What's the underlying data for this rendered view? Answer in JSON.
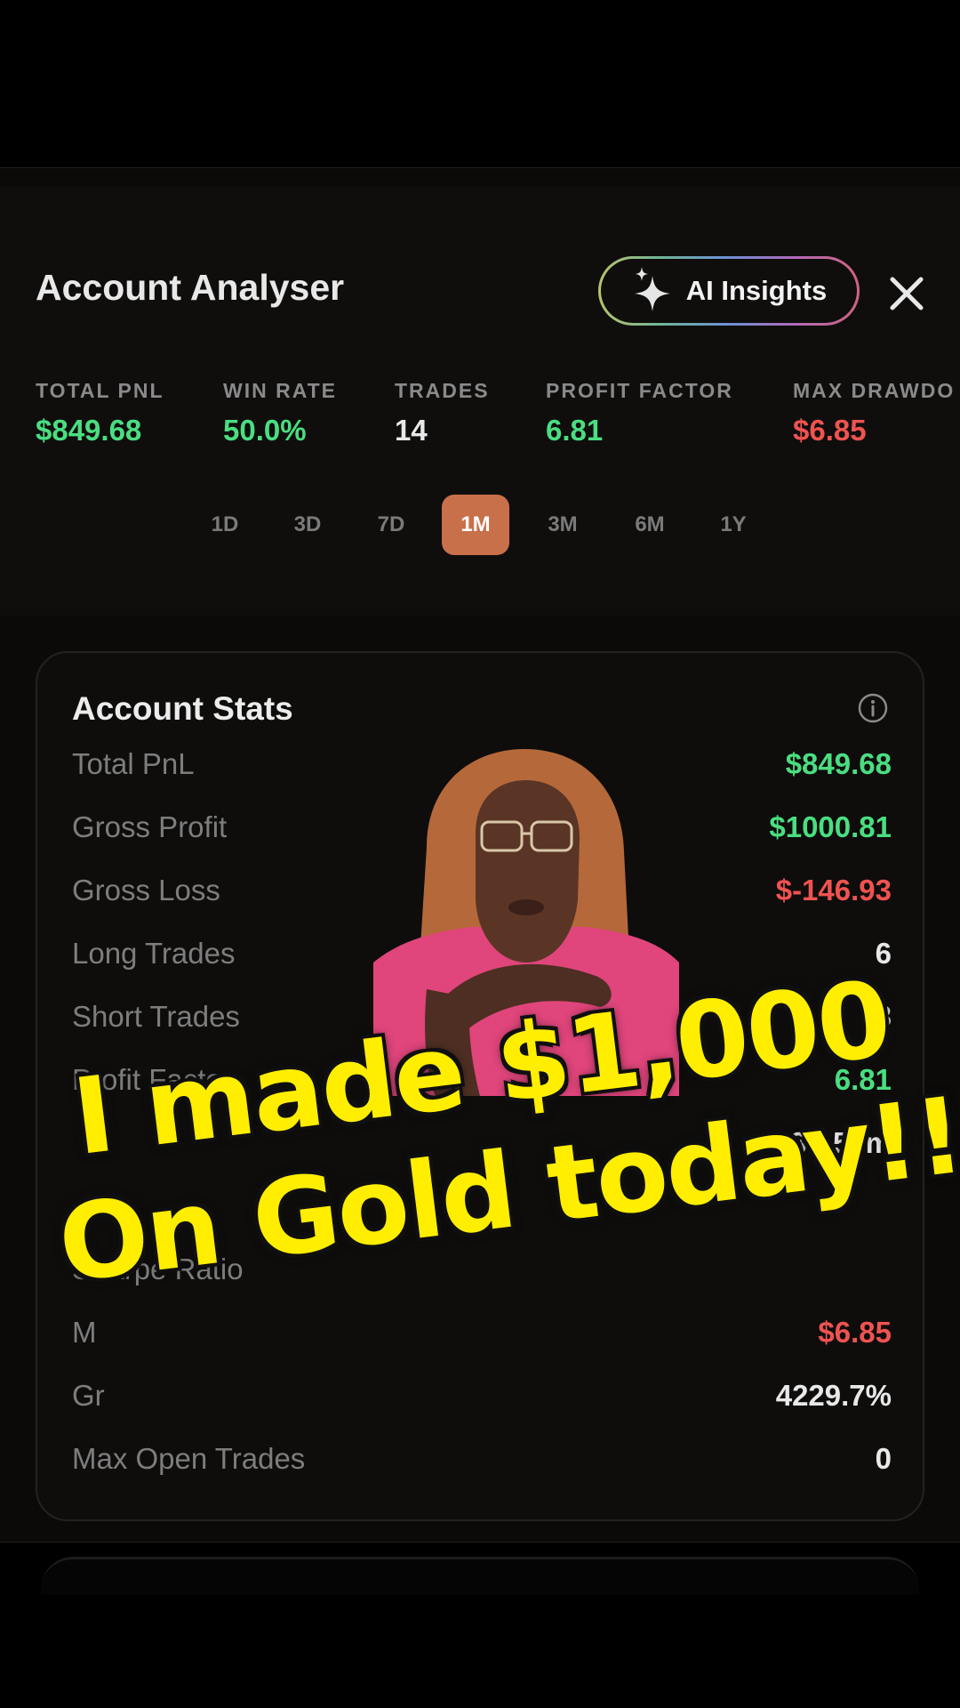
{
  "header": {
    "title": "Account Analyser",
    "ai_button_label": "AI Insights",
    "ai_icon": "sparkle-icon",
    "close_icon": "close-icon"
  },
  "metrics": [
    {
      "label": "TOTAL PNL",
      "value": "$849.68",
      "tone": "green"
    },
    {
      "label": "WIN RATE",
      "value": "50.0%",
      "tone": "green"
    },
    {
      "label": "TRADES",
      "value": "14",
      "tone": "white"
    },
    {
      "label": "PROFIT FACTOR",
      "value": "6.81",
      "tone": "green"
    },
    {
      "label": "MAX DRAWDO",
      "value": "$6.85",
      "tone": "red"
    }
  ],
  "ranges": {
    "items": [
      "1D",
      "3D",
      "7D",
      "1M",
      "3M",
      "6M",
      "1Y"
    ],
    "selected": "1M"
  },
  "account_stats": {
    "title": "Account Stats",
    "info_icon": "info-icon",
    "rows": [
      {
        "label": "Total PnL",
        "value": "$849.68",
        "tone": "green"
      },
      {
        "label": "Gross Profit",
        "value": "$1000.81",
        "tone": "green"
      },
      {
        "label": "Gross Loss",
        "value": "$-146.93",
        "tone": "red"
      },
      {
        "label": "Long Trades",
        "value": "6",
        "tone": "white"
      },
      {
        "label": "Short Trades",
        "value": "8",
        "tone": "white"
      },
      {
        "label": "Profit Factor",
        "value": "6.81",
        "tone": "green"
      },
      {
        "label": "",
        "value": "3h 55m",
        "tone": "white"
      },
      {
        "label": "",
        "value": "",
        "tone": "white"
      },
      {
        "label": "Sharpe Ratio",
        "value": "",
        "tone": "white"
      },
      {
        "label": "M",
        "value": "$6.85",
        "tone": "red"
      },
      {
        "label": "Gr",
        "value": "4229.7%",
        "tone": "white"
      },
      {
        "label": "Max Open Trades",
        "value": "0",
        "tone": "white"
      }
    ]
  },
  "overlay": {
    "line1": "I made $1,000",
    "line2": "On Gold today!!"
  },
  "colors": {
    "green": "#4ade80",
    "red": "#ef5350",
    "accent": "#c8704a",
    "caption_yellow": "#ffee00"
  }
}
